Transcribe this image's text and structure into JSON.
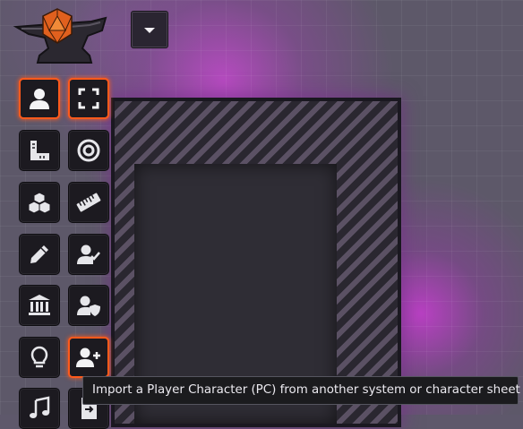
{
  "app": {
    "logo": "anvil-d20-logo"
  },
  "header": {
    "dropdown_icon": "caret-down-icon"
  },
  "tools": [
    {
      "icon": "user-icon",
      "active": true
    },
    {
      "icon": "expand-icon",
      "active": true
    },
    {
      "icon": "ruler-square-icon",
      "active": false
    },
    {
      "icon": "target-icon",
      "active": false
    },
    {
      "icon": "cubes-icon",
      "active": false
    },
    {
      "icon": "ruler-icon",
      "active": false
    },
    {
      "icon": "pencil-icon",
      "active": false
    },
    {
      "icon": "user-check-icon",
      "active": false
    },
    {
      "icon": "landmark-icon",
      "active": false
    },
    {
      "icon": "user-shield-icon",
      "active": false
    },
    {
      "icon": "lightbulb-icon",
      "active": false
    },
    {
      "icon": "user-plus-icon",
      "active": true
    },
    {
      "icon": "music-icon",
      "active": false
    },
    {
      "icon": "file-import-icon",
      "active": false
    }
  ],
  "tooltip": {
    "text": "Import a Player Character (PC) from another system or character sheet"
  },
  "colors": {
    "accent": "#ff5a1c",
    "panel": "#1c1a20",
    "glow": "#c845d8"
  }
}
